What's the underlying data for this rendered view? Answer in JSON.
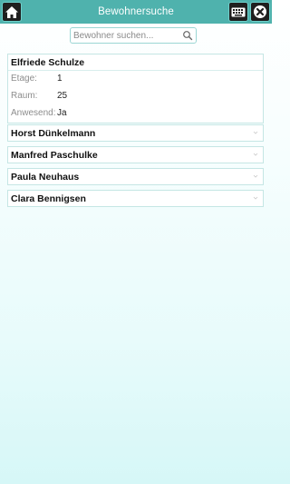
{
  "header": {
    "title": "Bewohnersuche"
  },
  "search": {
    "placeholder": "Bewohner suchen...",
    "value": ""
  },
  "residents": [
    {
      "name": "Elfriede Schulze",
      "expanded": true,
      "details": [
        {
          "label": "Etage:",
          "value": "1"
        },
        {
          "label": "Raum:",
          "value": "25"
        },
        {
          "label": "Anwesend:",
          "value": "Ja"
        }
      ]
    },
    {
      "name": "Horst Dünkelmann",
      "expanded": false
    },
    {
      "name": "Manfred Paschulke",
      "expanded": false
    },
    {
      "name": "Paula Neuhaus",
      "expanded": false
    },
    {
      "name": "Clara Bennigsen",
      "expanded": false
    }
  ],
  "colors": {
    "header": "#4fb2ad",
    "border": "#c5e6e4",
    "button": "#1f1f1f"
  },
  "icons": {
    "home": "home-icon",
    "keyboard": "keyboard-icon",
    "close": "close-icon",
    "search": "search-icon",
    "chevron": "chevron-down-icon"
  }
}
